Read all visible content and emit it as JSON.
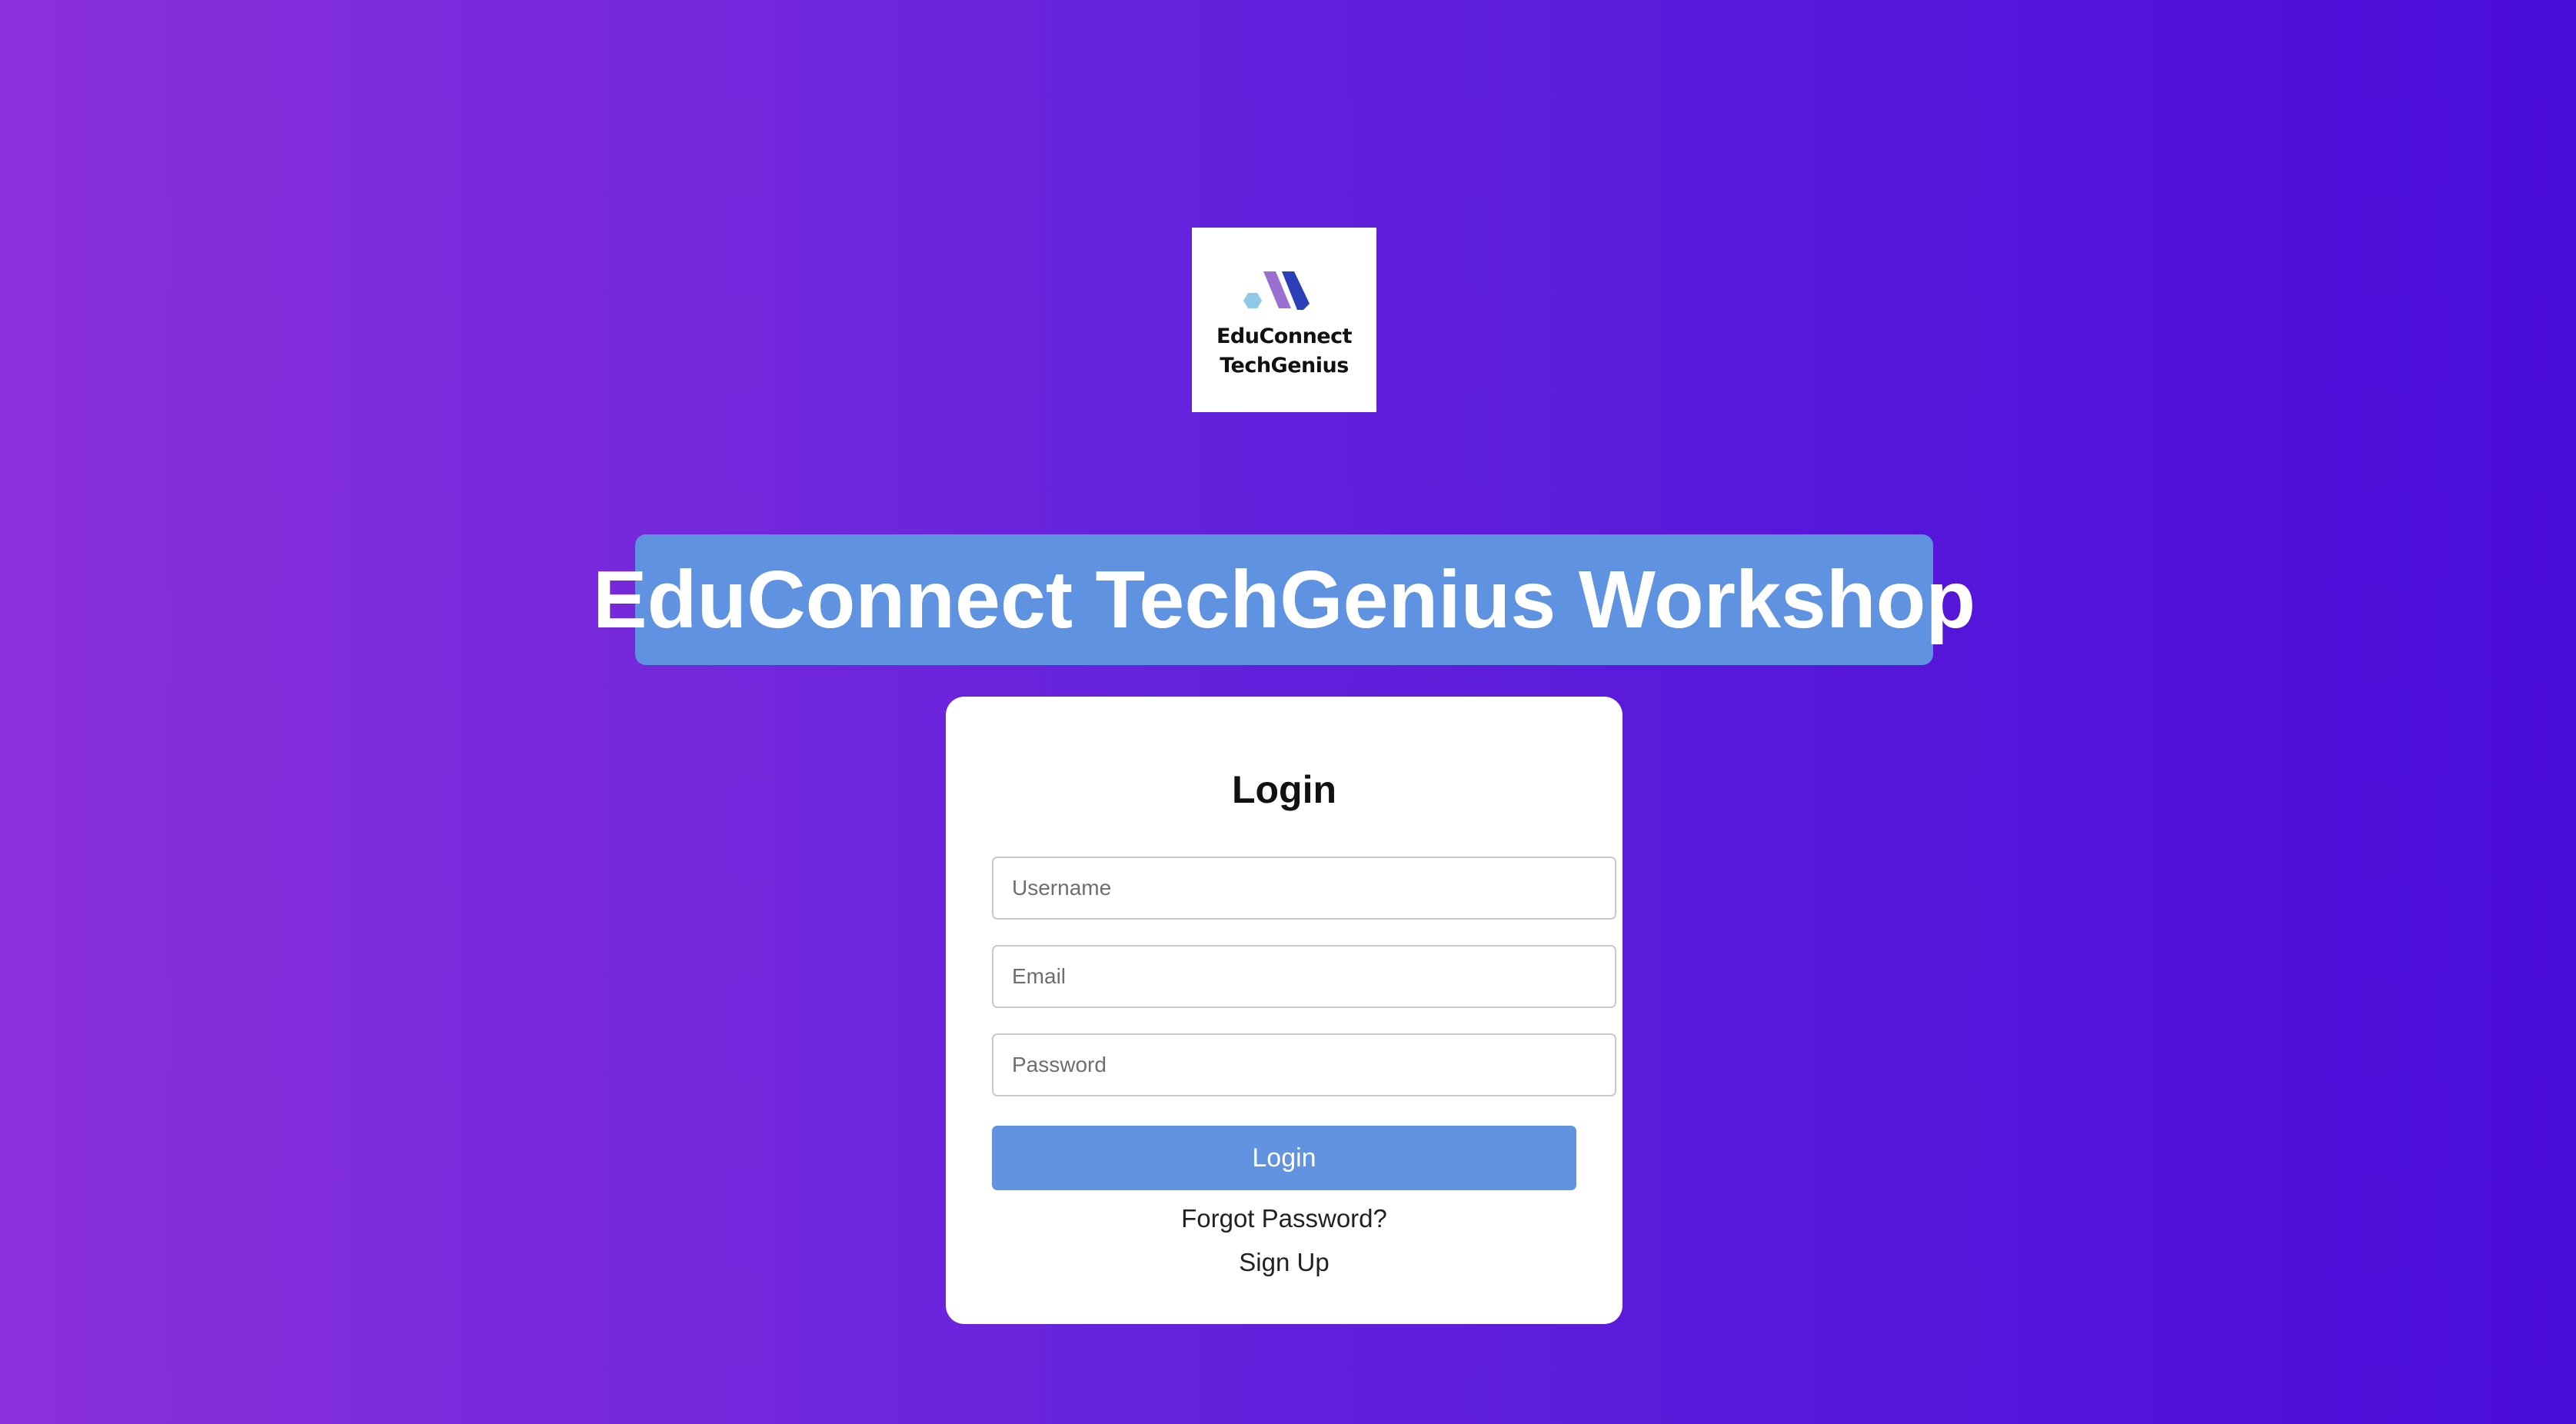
{
  "logo": {
    "line1": "EduConnect",
    "line2": "TechGenius",
    "colors": [
      "#8ecae6",
      "#9b6fd1",
      "#2b3fb8"
    ]
  },
  "title": "EduConnect TechGenius Workshop",
  "login_form": {
    "heading": "Login",
    "username_placeholder": "Username",
    "email_placeholder": "Email",
    "password_placeholder": "Password",
    "submit_label": "Login",
    "forgot_password_label": "Forgot Password?",
    "sign_up_label": "Sign Up"
  },
  "colors": {
    "background_start": "#8a30da",
    "background_end": "#4a0cd9",
    "accent": "#5f92e0",
    "card": "#ffffff"
  }
}
